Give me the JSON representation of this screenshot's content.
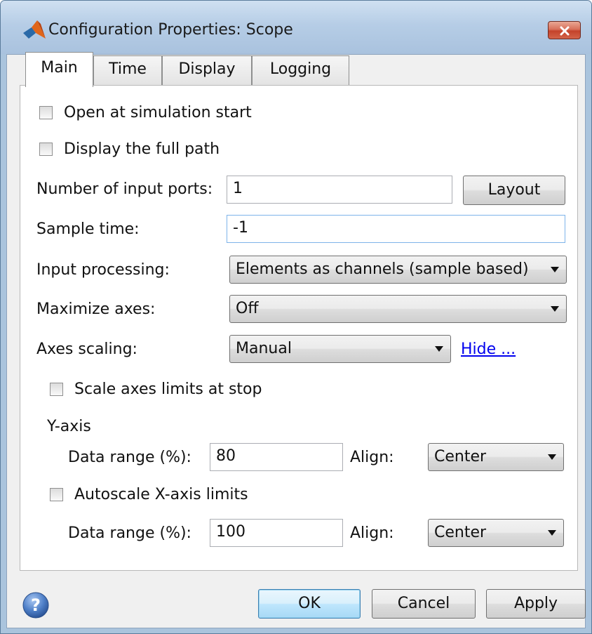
{
  "window": {
    "title": "Configuration Properties: Scope",
    "close_icon": "close-icon",
    "app_icon": "matlab-logo-icon"
  },
  "tabs": [
    {
      "label": "Main",
      "active": true
    },
    {
      "label": "Time",
      "active": false
    },
    {
      "label": "Display",
      "active": false
    },
    {
      "label": "Logging",
      "active": false
    }
  ],
  "main": {
    "open_at_start": {
      "label": "Open at simulation start",
      "checked": false
    },
    "display_full_path": {
      "label": "Display the full path",
      "checked": false
    },
    "num_input_ports": {
      "label": "Number of input ports:",
      "value": "1"
    },
    "layout_button": "Layout",
    "sample_time": {
      "label": "Sample time:",
      "value": "-1"
    },
    "input_processing": {
      "label": "Input processing:",
      "value": "Elements as channels (sample based)"
    },
    "maximize_axes": {
      "label": "Maximize axes:",
      "value": "Off"
    },
    "axes_scaling": {
      "label": "Axes scaling:",
      "value": "Manual",
      "link": "Hide ..."
    },
    "scale_limits_at_stop": {
      "label": "Scale axes limits at stop",
      "checked": false
    },
    "y_axis": {
      "heading": "Y-axis",
      "data_range_label": "Data range (%):",
      "data_range_value": "80",
      "align_label": "Align:",
      "align_value": "Center"
    },
    "autoscale_x": {
      "label": "Autoscale X-axis limits",
      "checked": false
    },
    "x_axis": {
      "data_range_label": "Data range (%):",
      "data_range_value": "100",
      "align_label": "Align:",
      "align_value": "Center"
    }
  },
  "footer": {
    "help_icon": "help-icon",
    "ok": "OK",
    "cancel": "Cancel",
    "apply": "Apply"
  },
  "colors": {
    "link": "#0000ee",
    "titlebar": "#b6cde6",
    "close_button": "#c4432b",
    "default_button_border": "#3c7fb1"
  }
}
